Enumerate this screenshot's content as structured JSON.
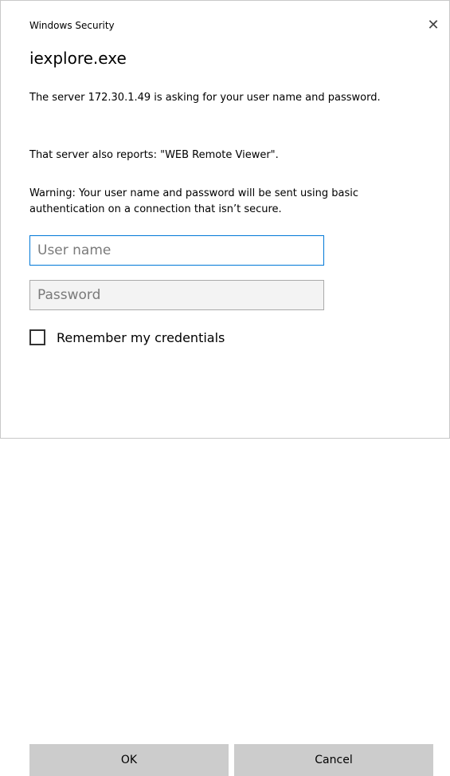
{
  "window": {
    "caption": "Windows Security",
    "close_glyph": "✕"
  },
  "dialog": {
    "app_title": "iexplore.exe",
    "message_server": "The server 172.30.1.49 is asking for your user name and password.",
    "message_realm": "That server also reports: \"WEB Remote Viewer\".",
    "message_warning": "Warning: Your user name and password will be sent using basic authentication on a connection that isn’t secure."
  },
  "form": {
    "username_placeholder": "User name",
    "username_value": "",
    "password_placeholder": "Password",
    "password_value": "",
    "remember_label": "Remember my credentials",
    "remember_checked": false
  },
  "buttons": {
    "ok_label": "OK",
    "cancel_label": "Cancel"
  },
  "colors": {
    "focus_border": "#0078d7",
    "button_bg": "#cccccc",
    "disabled_field_bg": "#f3f3f3"
  }
}
